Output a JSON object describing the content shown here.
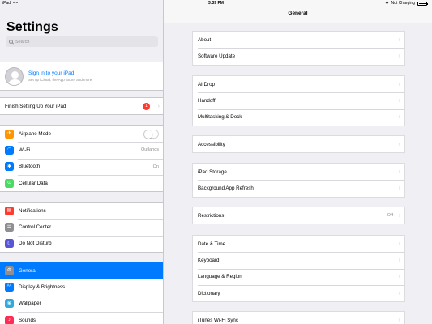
{
  "status_bar": {
    "device": "iPad",
    "time": "3:39 PM",
    "charging": "Not Charging"
  },
  "master": {
    "title": "Settings",
    "search_placeholder": "Search",
    "profile": {
      "title": "Sign in to your iPad",
      "subtitle": "Set up iCloud, the App Store, and more."
    },
    "setup": {
      "label": "Finish Setting Up Your iPad",
      "badge": "1"
    },
    "group1": [
      {
        "label": "Airplane Mode",
        "icon": "airplane-icon",
        "color": "#ff9500",
        "toggle": false
      },
      {
        "label": "Wi-Fi",
        "icon": "wifi-icon",
        "color": "#007aff",
        "value": "Outlands"
      },
      {
        "label": "Bluetooth",
        "icon": "bluetooth-icon",
        "color": "#007aff",
        "value": "On"
      },
      {
        "label": "Cellular Data",
        "icon": "antenna-icon",
        "color": "#4cd964"
      }
    ],
    "group2": [
      {
        "label": "Notifications",
        "icon": "notifications-icon",
        "color": "#ff3b30"
      },
      {
        "label": "Control Center",
        "icon": "control-center-icon",
        "color": "#8e8e93"
      },
      {
        "label": "Do Not Disturb",
        "icon": "moon-icon",
        "color": "#5856d6"
      }
    ],
    "group3": [
      {
        "label": "General",
        "icon": "gear-icon",
        "color": "#8e8e93",
        "selected": true
      },
      {
        "label": "Display & Brightness",
        "icon": "display-icon",
        "color": "#007aff"
      },
      {
        "label": "Wallpaper",
        "icon": "wallpaper-icon",
        "color": "#34aadc"
      },
      {
        "label": "Sounds",
        "icon": "speaker-icon",
        "color": "#ff2d55"
      }
    ]
  },
  "detail": {
    "title": "General",
    "sections": [
      [
        {
          "label": "About"
        },
        {
          "label": "Software Update"
        }
      ],
      [
        {
          "label": "AirDrop"
        },
        {
          "label": "Handoff"
        },
        {
          "label": "Multitasking & Dock"
        }
      ],
      [
        {
          "label": "Accessibility"
        }
      ],
      [
        {
          "label": "iPad Storage"
        },
        {
          "label": "Background App Refresh"
        }
      ],
      [
        {
          "label": "Restrictions",
          "value": "Off"
        }
      ],
      [
        {
          "label": "Date & Time"
        },
        {
          "label": "Keyboard"
        },
        {
          "label": "Language & Region"
        },
        {
          "label": "Dictionary"
        }
      ],
      [
        {
          "label": "iTunes Wi-Fi Sync"
        }
      ]
    ]
  },
  "colors": {
    "accent": "#007aff",
    "background": "#efeff4",
    "badge": "#ff3b30"
  }
}
